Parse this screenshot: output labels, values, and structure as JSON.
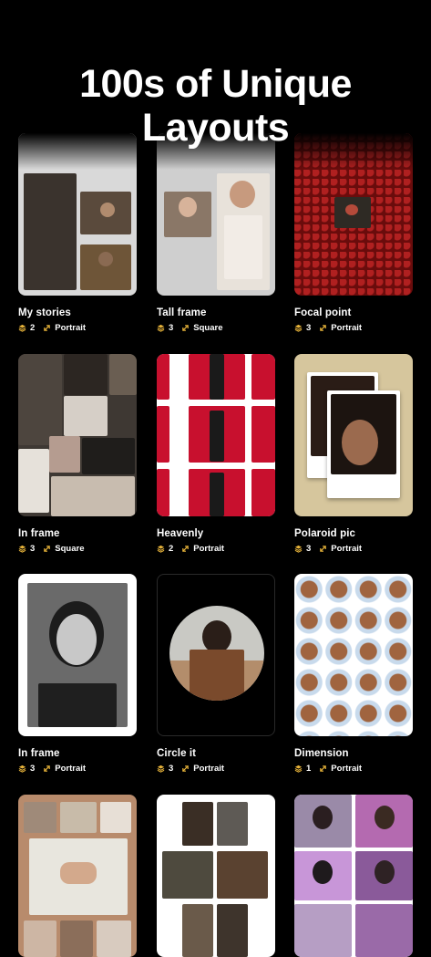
{
  "header": {
    "title_line1": "100s of Unique",
    "title_line2": "Layouts"
  },
  "colors": {
    "background": "#000000",
    "icon_gold": "#E8B43A",
    "text": "#FFFFFF"
  },
  "cards": [
    {
      "label": "My stories",
      "count": "2",
      "format": "Portrait"
    },
    {
      "label": "Tall frame",
      "count": "3",
      "format": "Square"
    },
    {
      "label": "Focal point",
      "count": "3",
      "format": "Portrait"
    },
    {
      "label": "In frame",
      "count": "3",
      "format": "Square"
    },
    {
      "label": "Heavenly",
      "count": "2",
      "format": "Portrait"
    },
    {
      "label": "Polaroid pic",
      "count": "3",
      "format": "Portrait"
    },
    {
      "label": "In frame",
      "count": "3",
      "format": "Portrait"
    },
    {
      "label": "Circle it",
      "count": "3",
      "format": "Portrait"
    },
    {
      "label": "Dimension",
      "count": "1",
      "format": "Portrait"
    },
    {
      "label": "",
      "count": "",
      "format": ""
    },
    {
      "label": "",
      "count": "",
      "format": ""
    },
    {
      "label": "",
      "count": "",
      "format": ""
    }
  ],
  "icons": {
    "count_icon": "layers-icon",
    "format_icon": "resize-arrow-icon"
  }
}
